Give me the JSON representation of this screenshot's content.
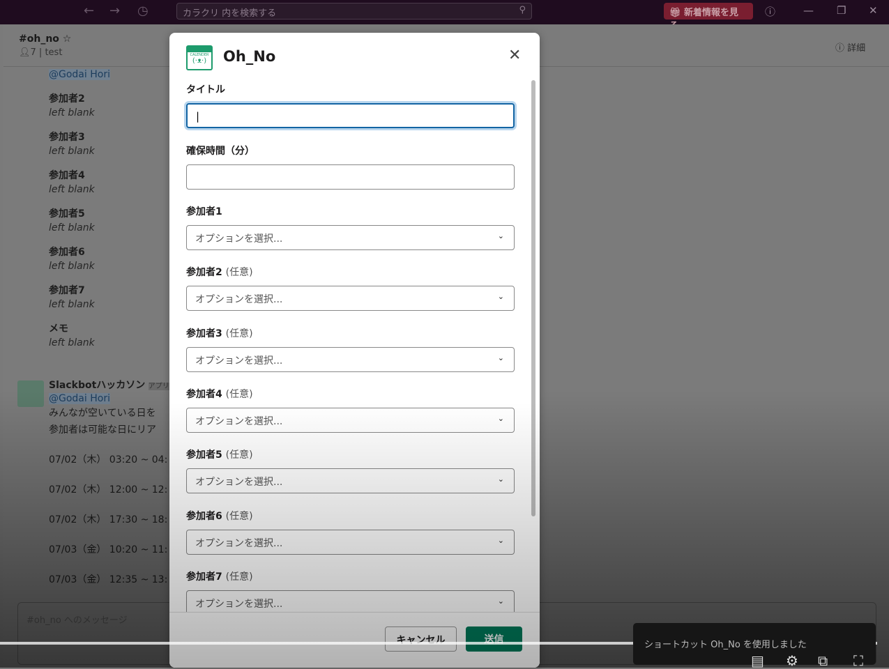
{
  "topbar": {
    "search_placeholder": "カラクリ 内を検索する",
    "whats_new": "新着情報を見る"
  },
  "channel": {
    "name": "#oh_no",
    "members": "7",
    "topic": "test",
    "details": "詳細"
  },
  "messages": {
    "mention": "@Godai Hori",
    "fields": [
      {
        "label": "参加者2",
        "value": "left blank"
      },
      {
        "label": "参加者3",
        "value": "left blank"
      },
      {
        "label": "参加者4",
        "value": "left blank"
      },
      {
        "label": "参加者5",
        "value": "left blank"
      },
      {
        "label": "参加者6",
        "value": "left blank"
      },
      {
        "label": "参加者7",
        "value": "left blank"
      },
      {
        "label": "メモ",
        "value": "left blank"
      }
    ],
    "bot": {
      "name": "Slackbotハッカソン",
      "badge": "アプリ",
      "mention": "@Godai Hori",
      "line1": "みんなが空いている日を",
      "line2": "参加者は可能な日にリア",
      "slots": [
        "07/02（木） 03:20 ~ 04:",
        "07/02（木） 12:00 ~ 12:",
        "07/02（木） 17:30 ~ 18:",
        "07/03（金） 10:20 ~ 11:",
        "07/03（金） 12:35 ~ 13:"
      ]
    }
  },
  "composer": {
    "placeholder": "#oh_no へのメッセージ"
  },
  "modal": {
    "app_icon_text": "CALENDER",
    "title": "Oh_No",
    "title_label": "タイトル",
    "duration_label": "確保時間（分）",
    "participant_placeholder": "オプションを選択...",
    "optional": "(任意)",
    "participants": [
      "参加者1",
      "参加者2",
      "参加者3",
      "参加者4",
      "参加者5",
      "参加者6",
      "参加者7"
    ],
    "cancel": "キャンセル",
    "submit": "送信"
  },
  "toast": "ショートカット Oh_No を使用しました"
}
